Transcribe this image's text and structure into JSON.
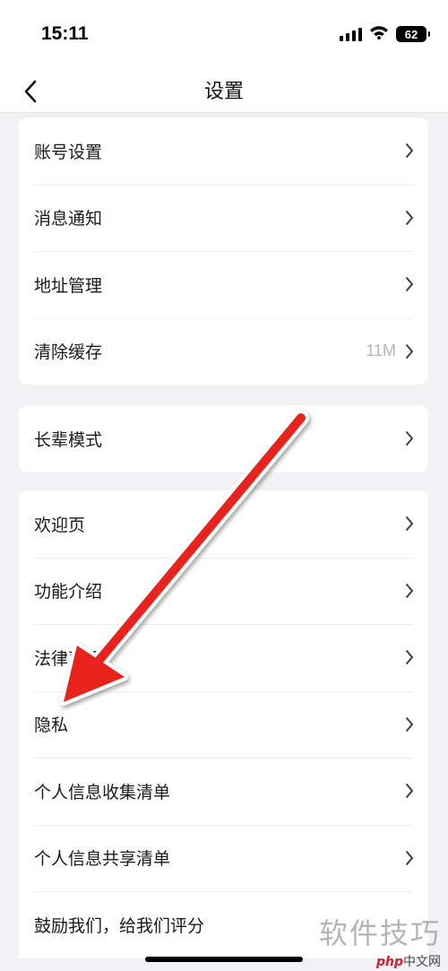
{
  "status_bar": {
    "time": "15:11",
    "battery": "62"
  },
  "nav": {
    "title": "设置"
  },
  "groups": [
    {
      "items": [
        {
          "label": "账号设置",
          "value": ""
        },
        {
          "label": "消息通知",
          "value": ""
        },
        {
          "label": "地址管理",
          "value": ""
        },
        {
          "label": "清除缓存",
          "value": "11M"
        }
      ]
    },
    {
      "items": [
        {
          "label": "长辈模式",
          "value": ""
        }
      ]
    },
    {
      "items": [
        {
          "label": "欢迎页",
          "value": ""
        },
        {
          "label": "功能介绍",
          "value": ""
        },
        {
          "label": "法律声明",
          "value": ""
        },
        {
          "label": "隐私",
          "value": ""
        },
        {
          "label": "个人信息收集清单",
          "value": ""
        },
        {
          "label": "个人信息共享清单",
          "value": ""
        },
        {
          "label": "鼓励我们，给我们评分",
          "value": ""
        }
      ]
    }
  ],
  "watermark": {
    "main": "软件技巧",
    "php": "php",
    "site": "中文网"
  },
  "annotation_color": "#e8211e"
}
